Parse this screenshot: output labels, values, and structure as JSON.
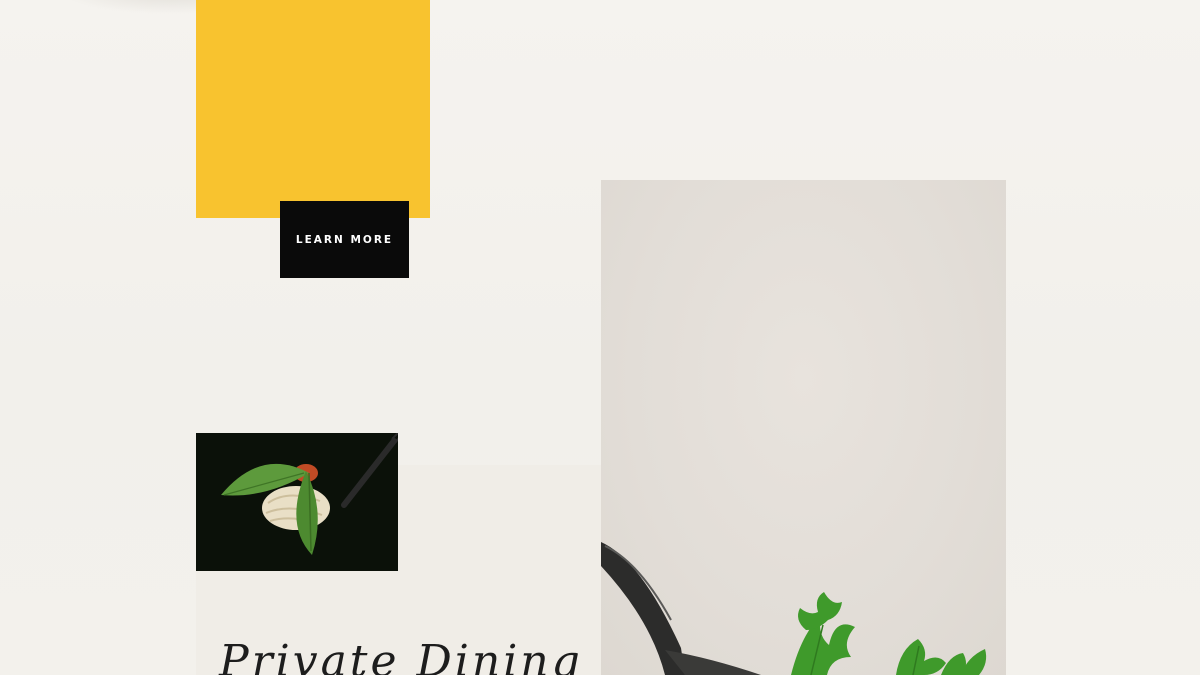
{
  "hero": {
    "learn_more_label": "LEARN MORE",
    "accent_color": "#f8c32f"
  },
  "feature": {
    "heading": "Private Dining"
  },
  "images": {
    "thumbnail": "pasta-on-fork-with-basil-image",
    "main_photo": "fork-with-parsley-image"
  }
}
